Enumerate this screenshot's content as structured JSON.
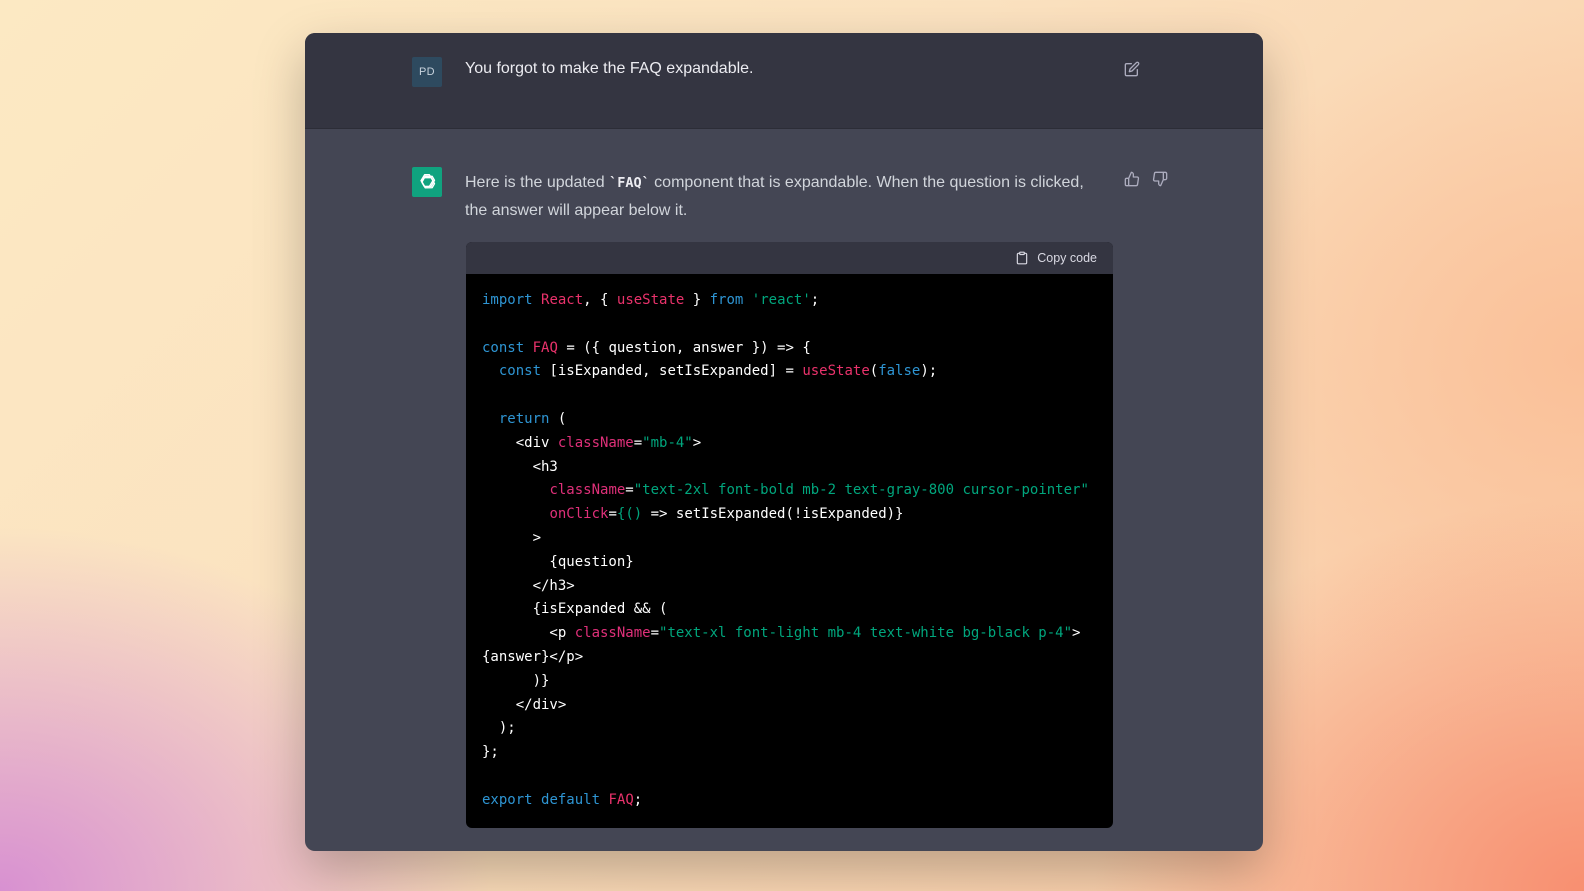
{
  "user_message": {
    "avatar_initials": "PD",
    "text": "You forgot to make the FAQ expandable.",
    "edit_icon": "edit-icon"
  },
  "assistant_message": {
    "avatar_icon": "openai-logo-icon",
    "text_before": "Here is the updated ",
    "inline_code": "`FAQ`",
    "text_after": " component that is expandable. When the question is clicked, the answer will appear below it.",
    "feedback": {
      "up_icon": "thumbs-up-icon",
      "down_icon": "thumbs-down-icon"
    }
  },
  "code_block": {
    "copy_label": "Copy code",
    "lines": [
      "import React, { useState } from 'react';",
      "",
      "const FAQ = ({ question, answer }) => {",
      "  const [isExpanded, setIsExpanded] = useState(false);",
      "",
      "  return (",
      "    <div className=\"mb-4\">",
      "      <h3",
      "        className=\"text-2xl font-bold mb-2 text-gray-800 cursor-pointer\"",
      "        onClick={() => setIsExpanded(!isExpanded)}",
      "      >",
      "        {question}",
      "      </h3>",
      "      {isExpanded && (",
      "        <p className=\"text-xl font-light mb-4 text-white bg-black p-4\">",
      "{answer}</p>",
      "      )}",
      "    </div>",
      "  );",
      "};",
      "",
      "export default FAQ;"
    ]
  },
  "colors": {
    "window_bg": "#444654",
    "user_row_bg": "#343541",
    "code_bg": "#000000",
    "keyword": "#2e95d3",
    "identifier_red": "#e9326b",
    "attribute": "#df3079",
    "string": "#00a67d",
    "ai_avatar_bg": "#10a37f"
  }
}
